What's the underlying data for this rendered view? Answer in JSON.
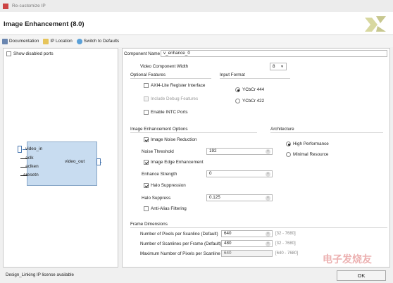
{
  "window": {
    "title": "Re-customize IP"
  },
  "header": {
    "title": "Image Enhancement (8.0)"
  },
  "toolbar": {
    "documentation": "Documentation",
    "ip_location": "IP Location",
    "switch_defaults": "Switch to Defaults"
  },
  "left": {
    "show_disabled_ports": "Show disabled ports",
    "show_disabled_checked": false,
    "ports_left": [
      "video_in",
      "aclk",
      "aclken",
      "aresetn"
    ],
    "port_right": "video_out"
  },
  "status": {
    "text": "Design_Linking IP license available"
  },
  "config": {
    "component_name_label": "Component Name",
    "component_name_value": "v_enhance_0",
    "video_width_label": "Video Component Width",
    "video_width_value": "8",
    "optional_features": {
      "title": "Optional Features",
      "axi_lite": {
        "label": "AXI4-Lite Register Interface",
        "checked": false
      },
      "debug": {
        "label": "Include Debug Features",
        "checked": false,
        "disabled": true
      },
      "intc": {
        "label": "Enable INTC Ports",
        "checked": false
      }
    },
    "input_format": {
      "title": "Input Format",
      "options": [
        "YCbCr 444",
        "YCbCr 422"
      ],
      "selected": "YCbCr 444"
    },
    "enhancement": {
      "title": "Image Enhancement Options",
      "noise_reduction": {
        "label": "Image Noise Reduction",
        "checked": true
      },
      "noise_threshold": {
        "label": "Noise Threshold",
        "value": "192"
      },
      "edge_enhancement": {
        "label": "Image Edge Enhancement",
        "checked": true
      },
      "enhance_strength": {
        "label": "Enhance Strength",
        "value": "0"
      },
      "halo_suppression": {
        "label": "Halo Suppression",
        "checked": true
      },
      "halo_suppress": {
        "label": "Halo Suppress",
        "value": "0.125"
      },
      "anti_alias": {
        "label": "Anti-Alias Filtering",
        "checked": false
      }
    },
    "architecture": {
      "title": "Architecture",
      "options": [
        "High Performance",
        "Minimal Resource"
      ],
      "selected": "High Performance"
    },
    "frame": {
      "title": "Frame Dimensions",
      "pixels_per_scanline": {
        "label": "Number of Pixels per Scanline (Default)",
        "value": "640",
        "range": "[32 - 7680]"
      },
      "scanlines_per_frame": {
        "label": "Number of Scanlines per Frame (Default)",
        "value": "480",
        "range": "[32 - 7680]"
      },
      "max_pixels": {
        "label": "Maximum Number of Pixels per Scanline",
        "value": "640",
        "range": "[640 - 7680]"
      }
    }
  },
  "footer": {
    "ok": "OK"
  },
  "watermark": "电子发烧友"
}
